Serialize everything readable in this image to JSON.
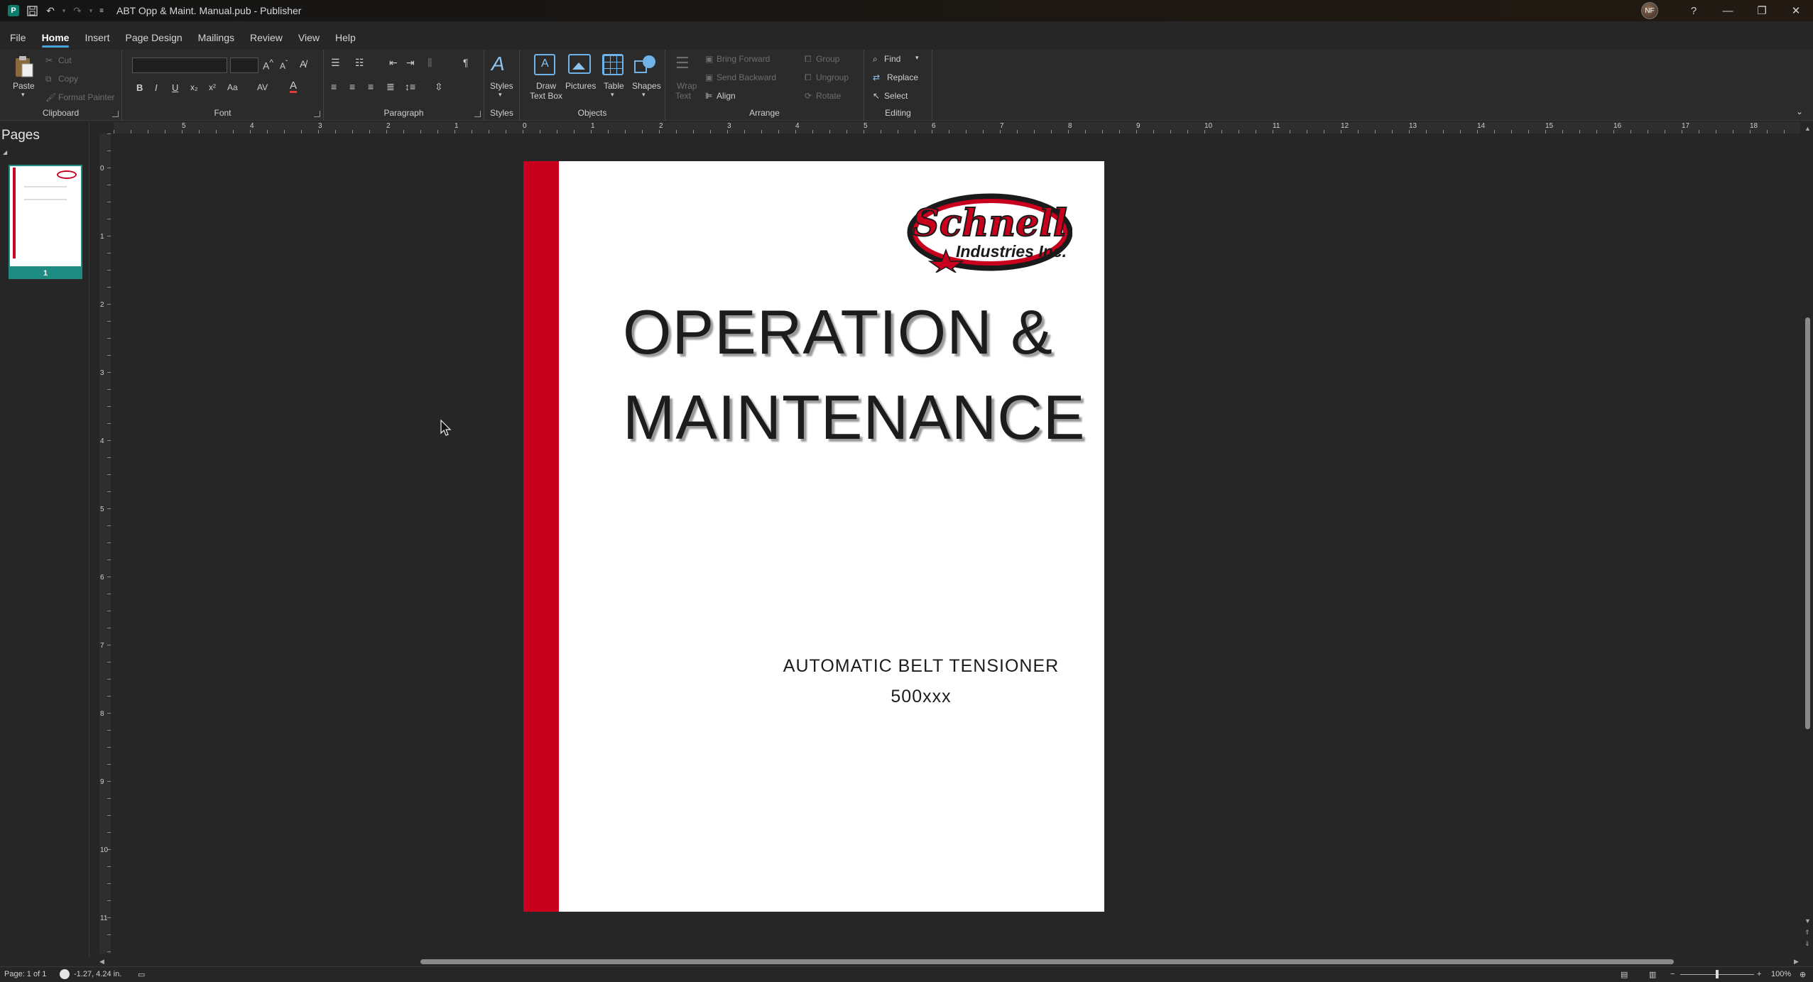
{
  "window": {
    "title": "ABT Opp & Maint. Manual.pub  -  Publisher",
    "avatar_initials": "NF",
    "help": "?",
    "minimize": "—",
    "restore": "❐",
    "close": "✕"
  },
  "menu_tabs": [
    "File",
    "Home",
    "Insert",
    "Page Design",
    "Mailings",
    "Review",
    "View",
    "Help"
  ],
  "ribbon": {
    "clipboard": {
      "label": "Clipboard",
      "paste": "Paste",
      "cut": "Cut",
      "copy": "Copy",
      "format_painter": "Format Painter"
    },
    "font": {
      "label": "Font",
      "bold": "B",
      "italic": "I",
      "underline": "U",
      "subscript": "x₂",
      "superscript": "x²",
      "change_case": "Aa"
    },
    "paragraph": {
      "label": "Paragraph",
      "show_marks": "¶"
    },
    "styles": {
      "label": "Styles",
      "button": "Styles"
    },
    "objects": {
      "label": "Objects",
      "draw_text_box_1": "Draw",
      "draw_text_box_2": "Text Box",
      "pictures": "Pictures",
      "table": "Table",
      "shapes": "Shapes"
    },
    "arrange": {
      "label": "Arrange",
      "wrap_text_1": "Wrap",
      "wrap_text_2": "Text",
      "bring_forward": "Bring Forward",
      "send_backward": "Send Backward",
      "align": "Align",
      "group": "Group",
      "ungroup": "Ungroup",
      "rotate": "Rotate"
    },
    "editing": {
      "label": "Editing",
      "find": "Find",
      "replace": "Replace",
      "select": "Select"
    }
  },
  "pages_pane": {
    "title": "Pages",
    "page_number": "1"
  },
  "ruler": {
    "h_numbers": [
      "5",
      "4",
      "3",
      "2",
      "1",
      "0",
      "1",
      "2",
      "3",
      "4",
      "5",
      "6",
      "7",
      "8",
      "9",
      "10",
      "11",
      "12",
      "13",
      "14",
      "15",
      "16",
      "17",
      "18"
    ],
    "v_numbers": [
      "0",
      "1",
      "2",
      "3",
      "4",
      "5",
      "6",
      "7",
      "8",
      "9",
      "10",
      "11"
    ]
  },
  "document": {
    "logo_text_1": "Schnell",
    "logo_text_2": "Industries Inc.",
    "headline_1": "OPERATION &",
    "headline_2": "MAINTENANCE",
    "subtitle_1": "AUTOMATIC BELT TENSIONER",
    "subtitle_2": "500xxx",
    "accent_color": "#c8001e"
  },
  "status": {
    "page": "Page: 1 of 1",
    "position": "-1.27, 4.24 in.",
    "zoom": "100%"
  }
}
